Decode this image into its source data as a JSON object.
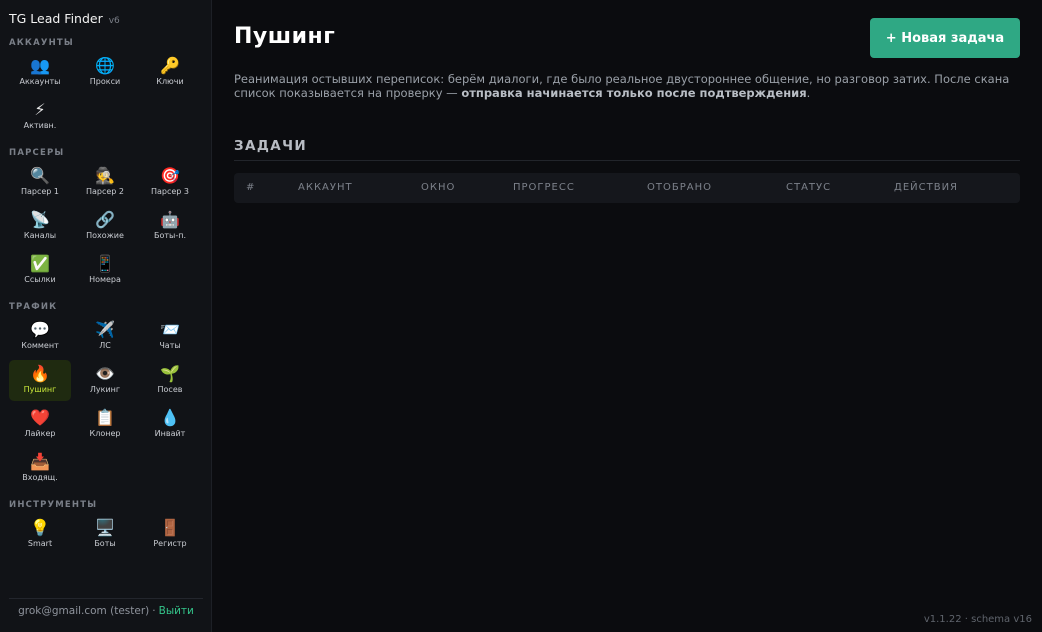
{
  "app": {
    "name": "TG Lead Finder",
    "version_tag": "v6"
  },
  "sidebar": {
    "sections": [
      {
        "title": "АККАУНТЫ",
        "items": [
          {
            "label": "Аккаунты",
            "icon": "👥",
            "icon_name": "users-icon"
          },
          {
            "label": "Прокси",
            "icon": "🌐",
            "icon_name": "globe-icon"
          },
          {
            "label": "Ключи",
            "icon": "🔑",
            "icon_name": "key-icon"
          },
          {
            "label": "Активн.",
            "icon": "⚡",
            "icon_name": "lightning-icon"
          }
        ]
      },
      {
        "title": "ПАРСЕРЫ",
        "items": [
          {
            "label": "Парсер 1",
            "icon": "🔍",
            "icon_name": "magnifier-icon"
          },
          {
            "label": "Парсер 2",
            "icon": "🕵️",
            "icon_name": "detective-icon"
          },
          {
            "label": "Парсер 3",
            "icon": "🎯",
            "icon_name": "target-icon"
          },
          {
            "label": "Каналы",
            "icon": "📡",
            "icon_name": "satellite-icon"
          },
          {
            "label": "Похожие",
            "icon": "🔗",
            "icon_name": "link-icon"
          },
          {
            "label": "Боты-п.",
            "icon": "🤖",
            "icon_name": "robot-icon"
          },
          {
            "label": "Ссылки",
            "icon": "✅",
            "icon_name": "check-icon"
          },
          {
            "label": "Номера",
            "icon": "📱",
            "icon_name": "phone-icon"
          }
        ]
      },
      {
        "title": "ТРАФИК",
        "items": [
          {
            "label": "Коммент",
            "icon": "💬",
            "icon_name": "speech-bubble-icon"
          },
          {
            "label": "ЛС",
            "icon": "✈️",
            "icon_name": "airplane-icon"
          },
          {
            "label": "Чаты",
            "icon": "📨",
            "icon_name": "envelope-icon"
          },
          {
            "label": "Пушинг",
            "icon": "🔥",
            "icon_name": "fire-icon",
            "active": true
          },
          {
            "label": "Лукинг",
            "icon": "👁️",
            "icon_name": "eye-icon"
          },
          {
            "label": "Посев",
            "icon": "🌱",
            "icon_name": "seedling-icon"
          },
          {
            "label": "Лайкер",
            "icon": "❤️",
            "icon_name": "heart-icon"
          },
          {
            "label": "Клонер",
            "icon": "📋",
            "icon_name": "clipboard-icon"
          },
          {
            "label": "Инвайт",
            "icon": "💧",
            "icon_name": "droplet-icon"
          },
          {
            "label": "Входящ.",
            "icon": "📥",
            "icon_name": "inbox-tray-icon"
          }
        ]
      },
      {
        "title": "ИНСТРУМЕНТЫ",
        "items": [
          {
            "label": "Smart",
            "icon": "💡",
            "icon_name": "lightbulb-icon"
          },
          {
            "label": "Боты",
            "icon": "🖥️",
            "icon_name": "desktop-icon"
          },
          {
            "label": "Регистр",
            "icon": "🚪",
            "icon_name": "door-icon"
          }
        ]
      }
    ],
    "footer": {
      "email": "grok@gmail.com (tester)",
      "separator": "·",
      "logout_label": "Выйти"
    }
  },
  "main": {
    "title": "Пушинг",
    "new_task_label": "+ Новая задача",
    "description_plain": "Реанимация остывших переписок: берём диалоги, где было реальное двустороннее общение, но разговор затих. После скана список показывается на проверку — ",
    "description_bold": "отправка начинается только после подтверждения",
    "description_end": ".",
    "tasks_title": "ЗАДАЧИ",
    "table_headers": [
      "#",
      "АККАУНТ",
      "ОКНО",
      "ПРОГРЕСС",
      "ОТОБРАНО",
      "СТАТУС",
      "ДЕЙСТВИЯ"
    ]
  },
  "version_footer": "v1.1.22 · schema v16",
  "colors": {
    "accent_green": "#2fa884",
    "active_label": "#c8e63a",
    "active_bg": "#1f2a10",
    "logout": "#34c48a"
  }
}
